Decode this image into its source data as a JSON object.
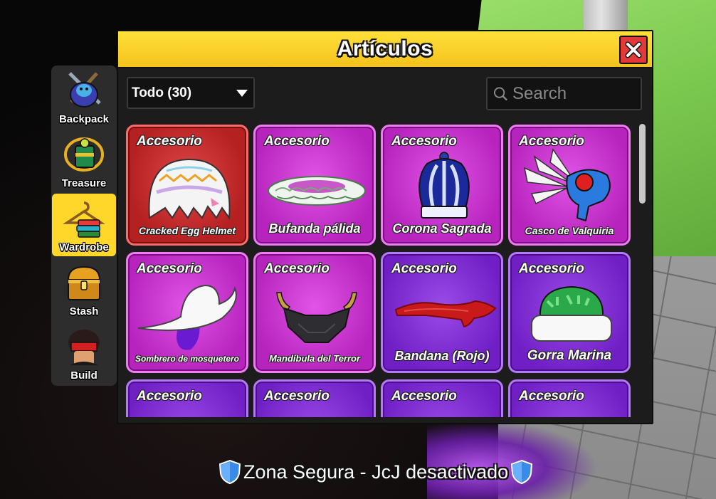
{
  "panel": {
    "title": "Artículos"
  },
  "sidebar": {
    "items": [
      {
        "label": "Backpack",
        "active": false
      },
      {
        "label": "Treasure",
        "active": false
      },
      {
        "label": "Wardrobe",
        "active": true
      },
      {
        "label": "Stash",
        "active": false
      },
      {
        "label": "Build",
        "active": false
      }
    ]
  },
  "filter": {
    "selected": "Todo (30)"
  },
  "search": {
    "placeholder": "Search",
    "value": ""
  },
  "items": [
    {
      "category": "Accesorio",
      "name": "Cracked Egg Helmet",
      "rarity": "red",
      "icon": "cracked-egg-helmet-icon"
    },
    {
      "category": "Accesorio",
      "name": "Bufanda pálida",
      "rarity": "pink",
      "icon": "pale-scarf-icon"
    },
    {
      "category": "Accesorio",
      "name": "Corona Sagrada",
      "rarity": "pink",
      "icon": "sacred-crown-icon"
    },
    {
      "category": "Accesorio",
      "name": "Casco de Valquiria",
      "rarity": "pink",
      "icon": "valkyrie-helm-icon"
    },
    {
      "category": "Accesorio",
      "name": "Sombrero de mosquetero",
      "rarity": "pink",
      "icon": "musketeer-hat-icon"
    },
    {
      "category": "Accesorio",
      "name": "Mandíbula del Terror",
      "rarity": "pink",
      "icon": "terror-jaw-icon"
    },
    {
      "category": "Accesorio",
      "name": "Bandana (Rojo)",
      "rarity": "purple",
      "icon": "red-bandana-icon"
    },
    {
      "category": "Accesorio",
      "name": "Gorra Marina",
      "rarity": "purple",
      "icon": "marine-cap-icon"
    },
    {
      "category": "Accesorio",
      "name": "",
      "rarity": "purple",
      "icon": "accessory-icon"
    },
    {
      "category": "Accesorio",
      "name": "",
      "rarity": "purple",
      "icon": "accessory-icon"
    },
    {
      "category": "Accesorio",
      "name": "",
      "rarity": "purple",
      "icon": "accessory-icon"
    },
    {
      "category": "Accesorio",
      "name": "",
      "rarity": "purple",
      "icon": "accessory-icon"
    }
  ],
  "status": {
    "text": "Zona Segura - JcJ desactivado",
    "icon": "shield-icon"
  },
  "colors": {
    "header": "#f5c21c",
    "close": "#e23a3a",
    "active_tab": "#ffd62a",
    "rarity_red": "#c22a2a",
    "rarity_pink": "#c22bc9",
    "rarity_purple": "#7d2ad0"
  }
}
